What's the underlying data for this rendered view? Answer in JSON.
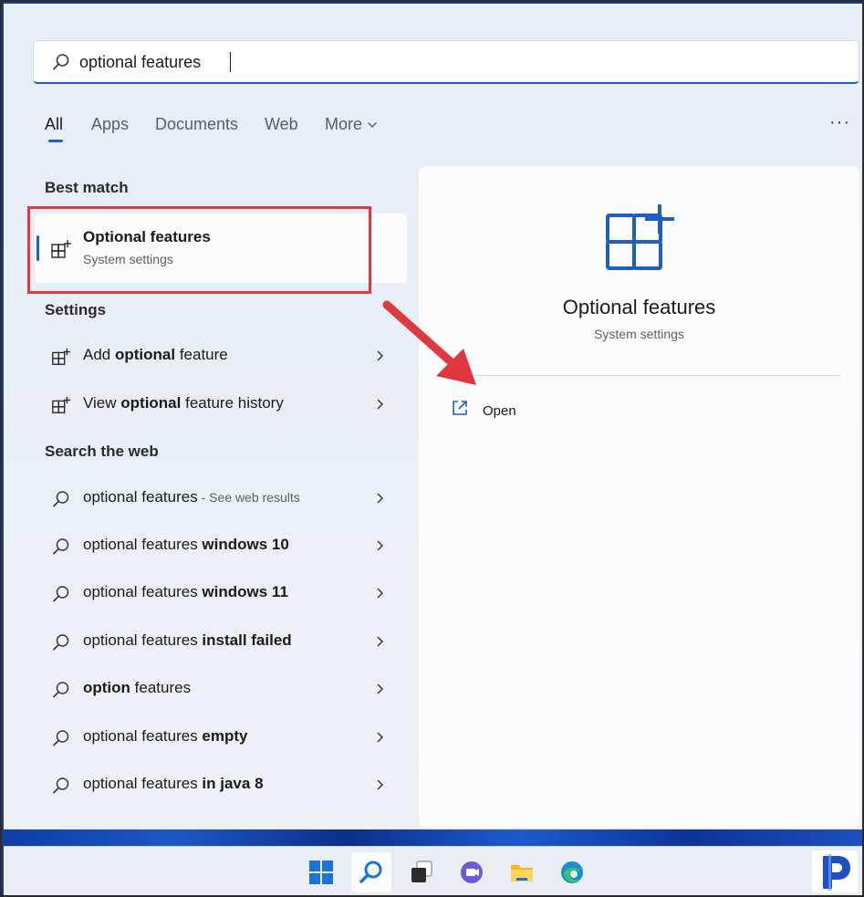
{
  "search": {
    "value": "optional features",
    "icon": "search-icon"
  },
  "tabs": [
    {
      "label": "All",
      "active": true
    },
    {
      "label": "Apps"
    },
    {
      "label": "Documents"
    },
    {
      "label": "Web"
    },
    {
      "label": "More"
    }
  ],
  "overflow_menu": "···",
  "best_match": {
    "heading": "Best match",
    "title": "Optional features",
    "subtitle": "System settings",
    "icon": "optional-features-icon"
  },
  "settings": {
    "heading": "Settings",
    "items": [
      {
        "pre": "Add ",
        "bold": "optional",
        "post": " feature",
        "icon": "optional-features-icon"
      },
      {
        "pre": "View ",
        "bold": "optional",
        "post": " feature history",
        "icon": "optional-features-icon"
      }
    ]
  },
  "web": {
    "heading": "Search the web",
    "items": [
      {
        "pre": "optional features",
        "bold": "",
        "muted": " - See web results"
      },
      {
        "pre": "optional features ",
        "bold": "windows 10",
        "muted": ""
      },
      {
        "pre": "optional features ",
        "bold": "windows 11",
        "muted": ""
      },
      {
        "pre": "optional features ",
        "bold": "install failed",
        "muted": ""
      },
      {
        "pre": "",
        "bold": "option",
        "post": " features",
        "muted": ""
      },
      {
        "pre": "optional features ",
        "bold": "empty",
        "muted": ""
      },
      {
        "pre": "optional features ",
        "bold": "in java 8",
        "muted": ""
      }
    ]
  },
  "preview": {
    "title": "Optional features",
    "subtitle": "System settings",
    "open_label": "Open"
  },
  "colors": {
    "accent": "#1f5fc0",
    "highlight_box": "#e0383e",
    "annotation_arrow": "#e0383e"
  },
  "taskbar": {
    "icons": [
      "start-icon",
      "search-icon",
      "task-view-icon",
      "chat-icon",
      "file-explorer-icon",
      "edge-icon"
    ],
    "brand": "brand-logo-icon"
  }
}
